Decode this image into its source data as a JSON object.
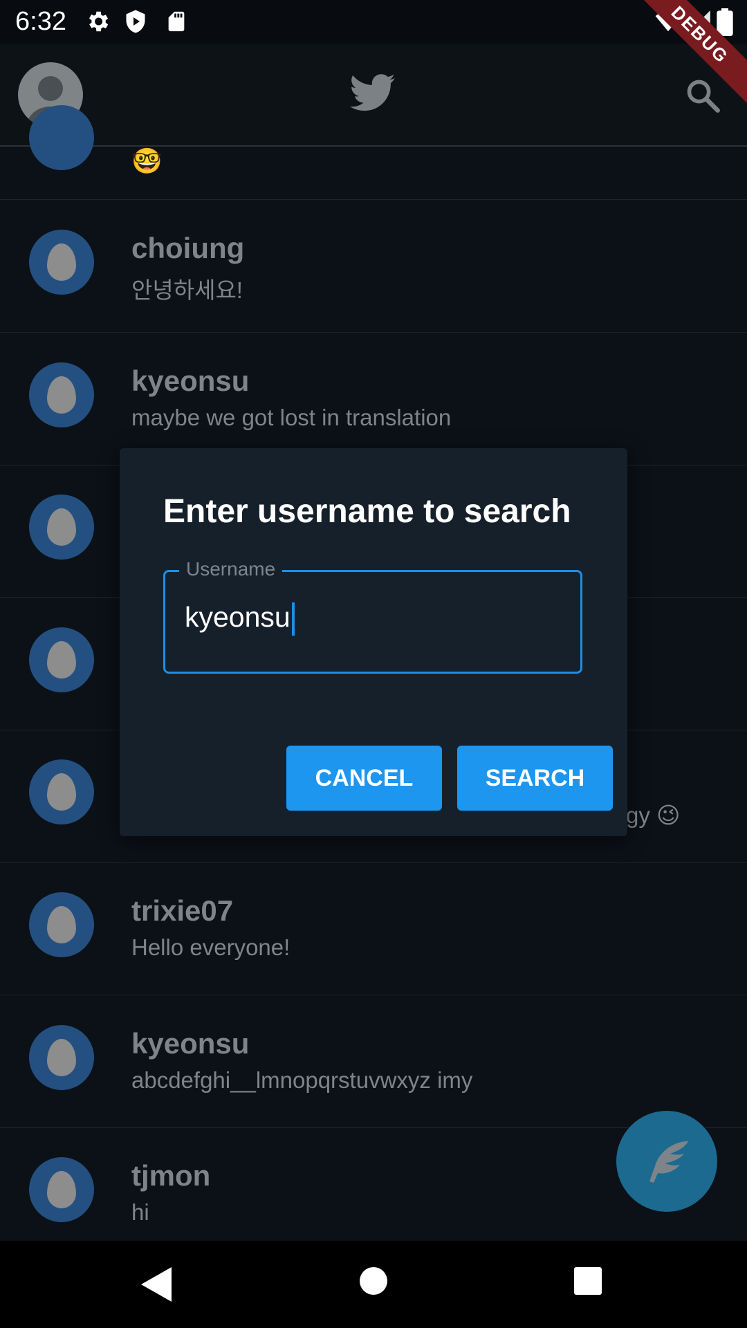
{
  "status_bar": {
    "time": "6:32",
    "left_icons": [
      "settings-icon",
      "shield-play-icon",
      "sd-card-icon"
    ],
    "right_icons": [
      "wifi-icon",
      "signal-icon",
      "battery-icon"
    ]
  },
  "debug_banner": "DEBUG",
  "app_bar": {
    "logo": "twitter-bird-icon",
    "search_icon": "search-icon"
  },
  "feed": {
    "partial_item_emoji": "🤓",
    "items": [
      {
        "username": "choiung",
        "text": "안녕하세요!"
      },
      {
        "username": "kyeonsu",
        "text": "maybe we got lost in translation"
      },
      {
        "username": "",
        "text": ""
      },
      {
        "username": "",
        "text": ""
      },
      {
        "username": "",
        "text": "gy 😉"
      },
      {
        "username": "trixie07",
        "text": "Hello everyone!"
      },
      {
        "username": "kyeonsu",
        "text": "abcdefghi__lmnopqrstuvwxyz imy"
      },
      {
        "username": "tjmon",
        "text": "hi"
      }
    ]
  },
  "dialog": {
    "title": "Enter username to search",
    "field_label": "Username",
    "field_value": "kyeonsu",
    "cancel_label": "CANCEL",
    "search_label": "SEARCH"
  },
  "fab": {
    "icon": "feather-icon"
  },
  "nav_bar": {
    "icons": [
      "back-icon",
      "home-icon",
      "recents-icon"
    ]
  },
  "colors": {
    "accent": "#1d96f0",
    "background": "#0c1117",
    "dialog": "#16202a"
  }
}
